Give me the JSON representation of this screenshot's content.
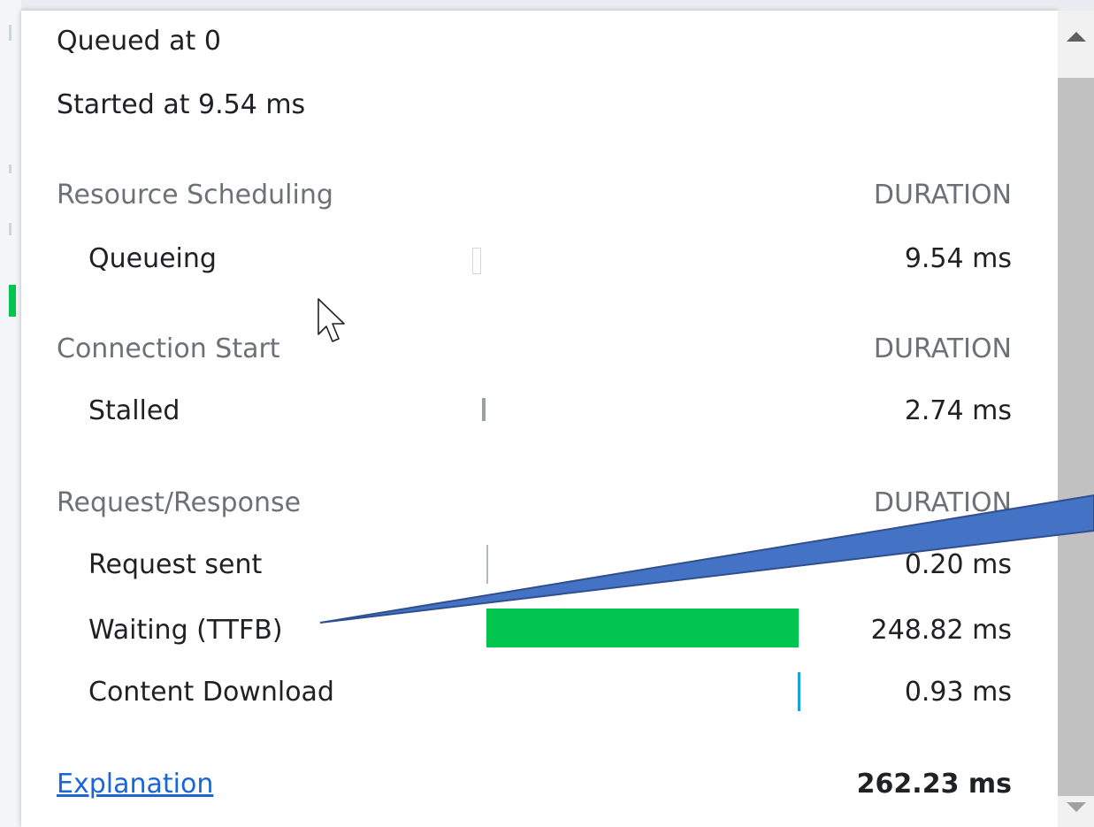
{
  "timing": {
    "queued_at": "Queued at 0",
    "started_at": "Started at 9.54 ms"
  },
  "sections": {
    "resource_scheduling": {
      "title": "Resource Scheduling",
      "duration_header": "DURATION",
      "rows": [
        {
          "label": "Queueing",
          "value": "9.54 ms"
        }
      ]
    },
    "connection_start": {
      "title": "Connection Start",
      "duration_header": "DURATION",
      "rows": [
        {
          "label": "Stalled",
          "value": "2.74 ms"
        }
      ]
    },
    "request_response": {
      "title": "Request/Response",
      "duration_header": "DURATION",
      "rows": [
        {
          "label": "Request sent",
          "value": "0.20 ms"
        },
        {
          "label": "Waiting (TTFB)",
          "value": "248.82 ms"
        },
        {
          "label": "Content Download",
          "value": "0.93 ms"
        }
      ]
    }
  },
  "footer": {
    "explanation_link": "Explanation",
    "total": "262.23 ms"
  },
  "colors": {
    "waiting_bar": "#00c650",
    "download_bar": "#1a9fe0",
    "request_bar": "#b0b8c4",
    "link": "#1a66d6",
    "callout": "#3a5fbf"
  },
  "icons": {
    "cursor": "mouse-pointer-icon",
    "scroll_up": "triangle-up-icon",
    "scroll_down": "triangle-down-icon"
  }
}
